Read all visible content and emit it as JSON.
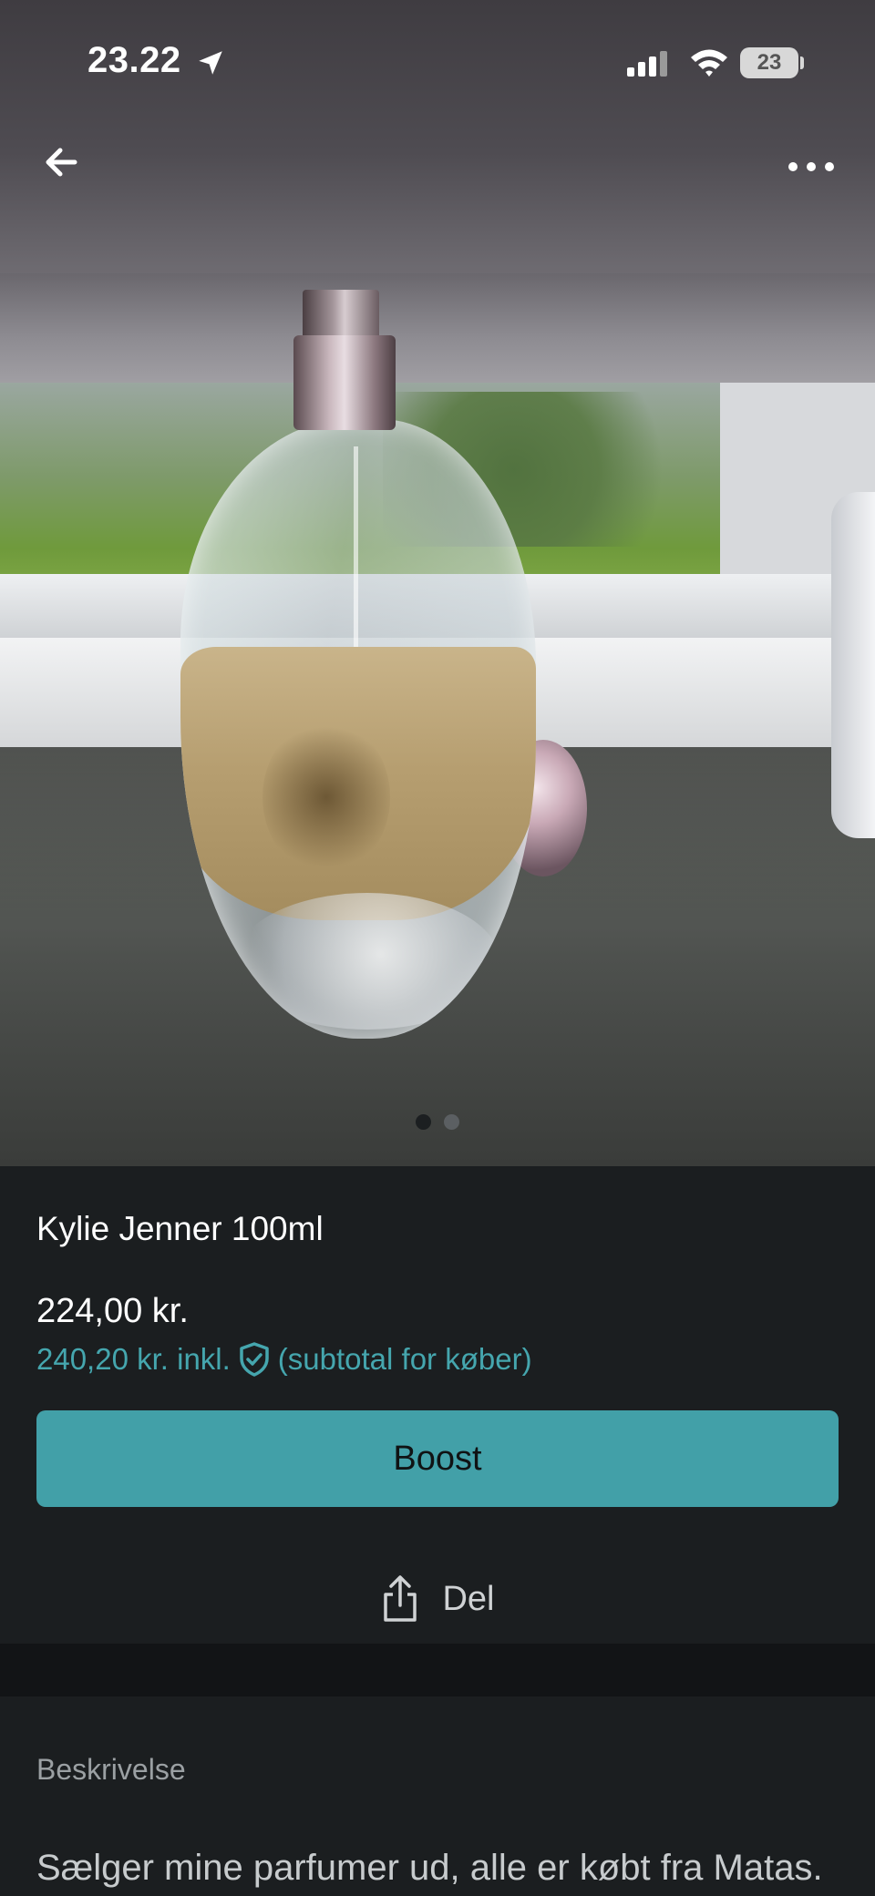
{
  "status_bar": {
    "time": "23.22",
    "battery": "23"
  },
  "listing": {
    "title": "Kylie Jenner 100ml",
    "price": "224,00 kr.",
    "subtotal_amount": "240,20 kr. inkl.",
    "subtotal_note": "(subtotal for køber)",
    "image_count": 2,
    "active_image": 1
  },
  "actions": {
    "boost_label": "Boost",
    "share_label": "Del"
  },
  "description": {
    "heading": "Beskrivelse",
    "text": "Sælger mine parfumer ud, alle er købt fra Matas."
  },
  "colors": {
    "accent": "#42a0a8",
    "background": "#1b1e20",
    "link_teal": "#45a6ae"
  },
  "icons": [
    "location-arrow-icon",
    "signal-icon",
    "wifi-icon",
    "battery-icon",
    "back-arrow-icon",
    "more-icon",
    "shield-check-icon",
    "share-icon"
  ]
}
